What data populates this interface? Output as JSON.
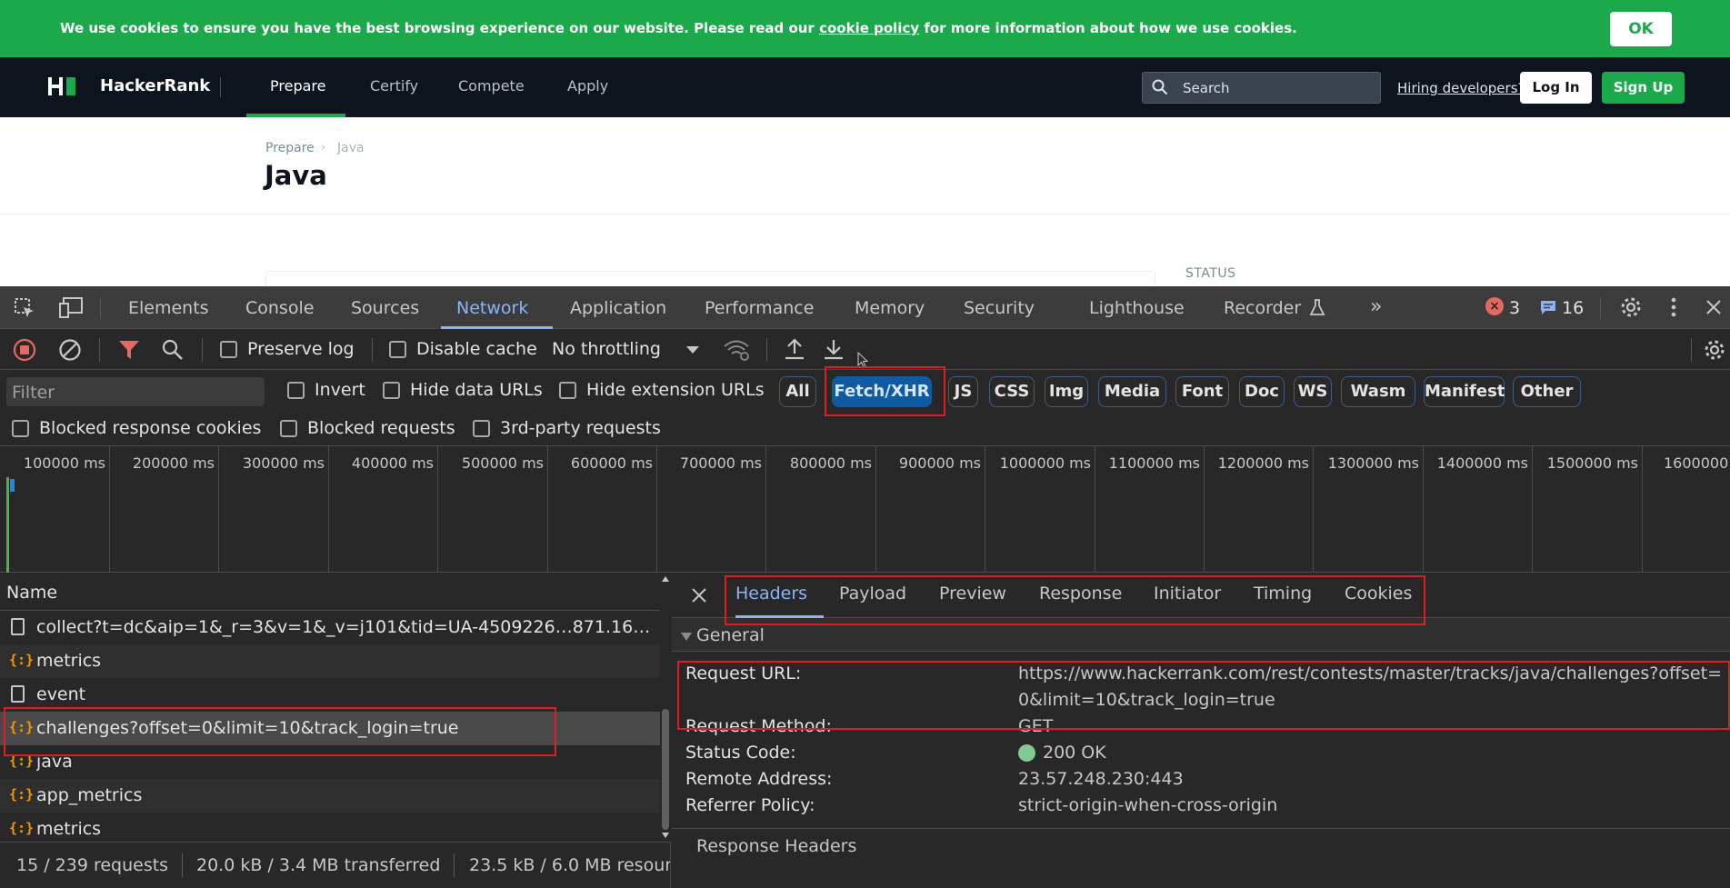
{
  "cookie_bar": {
    "text_before": "We use cookies to ensure you have the best browsing experience on our website. Please read our ",
    "link": "cookie policy",
    "text_after": " for more information about how we use cookies.",
    "ok_label": "OK"
  },
  "site_nav": {
    "brand": "HackerRank",
    "items": [
      "Prepare",
      "Certify",
      "Compete",
      "Apply"
    ],
    "search_placeholder": "Search",
    "hiring_link": "Hiring developers?",
    "login_label": "Log In",
    "signup_label": "Sign Up"
  },
  "page": {
    "breadcrumb": [
      "Prepare",
      "Java"
    ],
    "title": "Java",
    "status_label": "STATUS"
  },
  "devtools": {
    "tabs": [
      "Elements",
      "Console",
      "Sources",
      "Network",
      "Application",
      "Performance",
      "Memory",
      "Security",
      "Lighthouse",
      "Recorder"
    ],
    "active_tab": "Network",
    "error_count": "3",
    "message_count": "16",
    "toolbar": {
      "preserve_log": "Preserve log",
      "disable_cache": "Disable cache",
      "throttling": "No throttling"
    },
    "filter": {
      "placeholder": "Filter",
      "invert": "Invert",
      "hide_data_urls": "Hide data URLs",
      "hide_extension_urls": "Hide extension URLs",
      "types": [
        "All",
        "Fetch/XHR",
        "JS",
        "CSS",
        "Img",
        "Media",
        "Font",
        "Doc",
        "WS",
        "Wasm",
        "Manifest",
        "Other"
      ],
      "active_type": "Fetch/XHR",
      "blocked_response_cookies": "Blocked response cookies",
      "blocked_requests": "Blocked requests",
      "third_party": "3rd-party requests"
    },
    "timeline_labels": [
      "100000 ms",
      "200000 ms",
      "300000 ms",
      "400000 ms",
      "500000 ms",
      "600000 ms",
      "700000 ms",
      "800000 ms",
      "900000 ms",
      "1000000 ms",
      "1100000 ms",
      "1200000 ms",
      "1300000 ms",
      "1400000 ms",
      "1500000 ms",
      "1600000"
    ],
    "requests": {
      "column_name": "Name",
      "rows": [
        {
          "name": "collect?t=dc&aip=1&_r=3&v=1&_v=j101&tid=UA-4509226…871.1697…",
          "type": "doc"
        },
        {
          "name": "metrics",
          "type": "xhr"
        },
        {
          "name": "event",
          "type": "doc"
        },
        {
          "name": "challenges?offset=0&limit=10&track_login=true",
          "type": "xhr"
        },
        {
          "name": "java",
          "type": "xhr"
        },
        {
          "name": "app_metrics",
          "type": "xhr"
        },
        {
          "name": "metrics",
          "type": "xhr"
        }
      ]
    },
    "status_bar": {
      "requests": "15 / 239 requests",
      "transferred": "20.0 kB / 3.4 MB transferred",
      "resources": "23.5 kB / 6.0 MB resour"
    },
    "details": {
      "tabs": [
        "Headers",
        "Payload",
        "Preview",
        "Response",
        "Initiator",
        "Timing",
        "Cookies"
      ],
      "active_tab": "Headers",
      "general_label": "General",
      "request_url_key": "Request URL:",
      "request_url_line1": "https://www.hackerrank.com/rest/contests/master/tracks/java/challenges?offset=",
      "request_url_line2": "0&limit=10&track_login=true",
      "method_key": "Request Method:",
      "method_val": "GET",
      "status_key": "Status Code:",
      "status_val": "200 OK",
      "remote_key": "Remote Address:",
      "remote_val": "23.57.248.230:443",
      "referrer_key": "Referrer Policy:",
      "referrer_val": "strict-origin-when-cross-origin",
      "response_headers": "Response Headers"
    }
  },
  "colors": {
    "brand_green": "#1ba94c",
    "nav_dark": "#0e141e",
    "devtools_accent": "#8ab4f8",
    "highlight_red": "#e01b24"
  }
}
